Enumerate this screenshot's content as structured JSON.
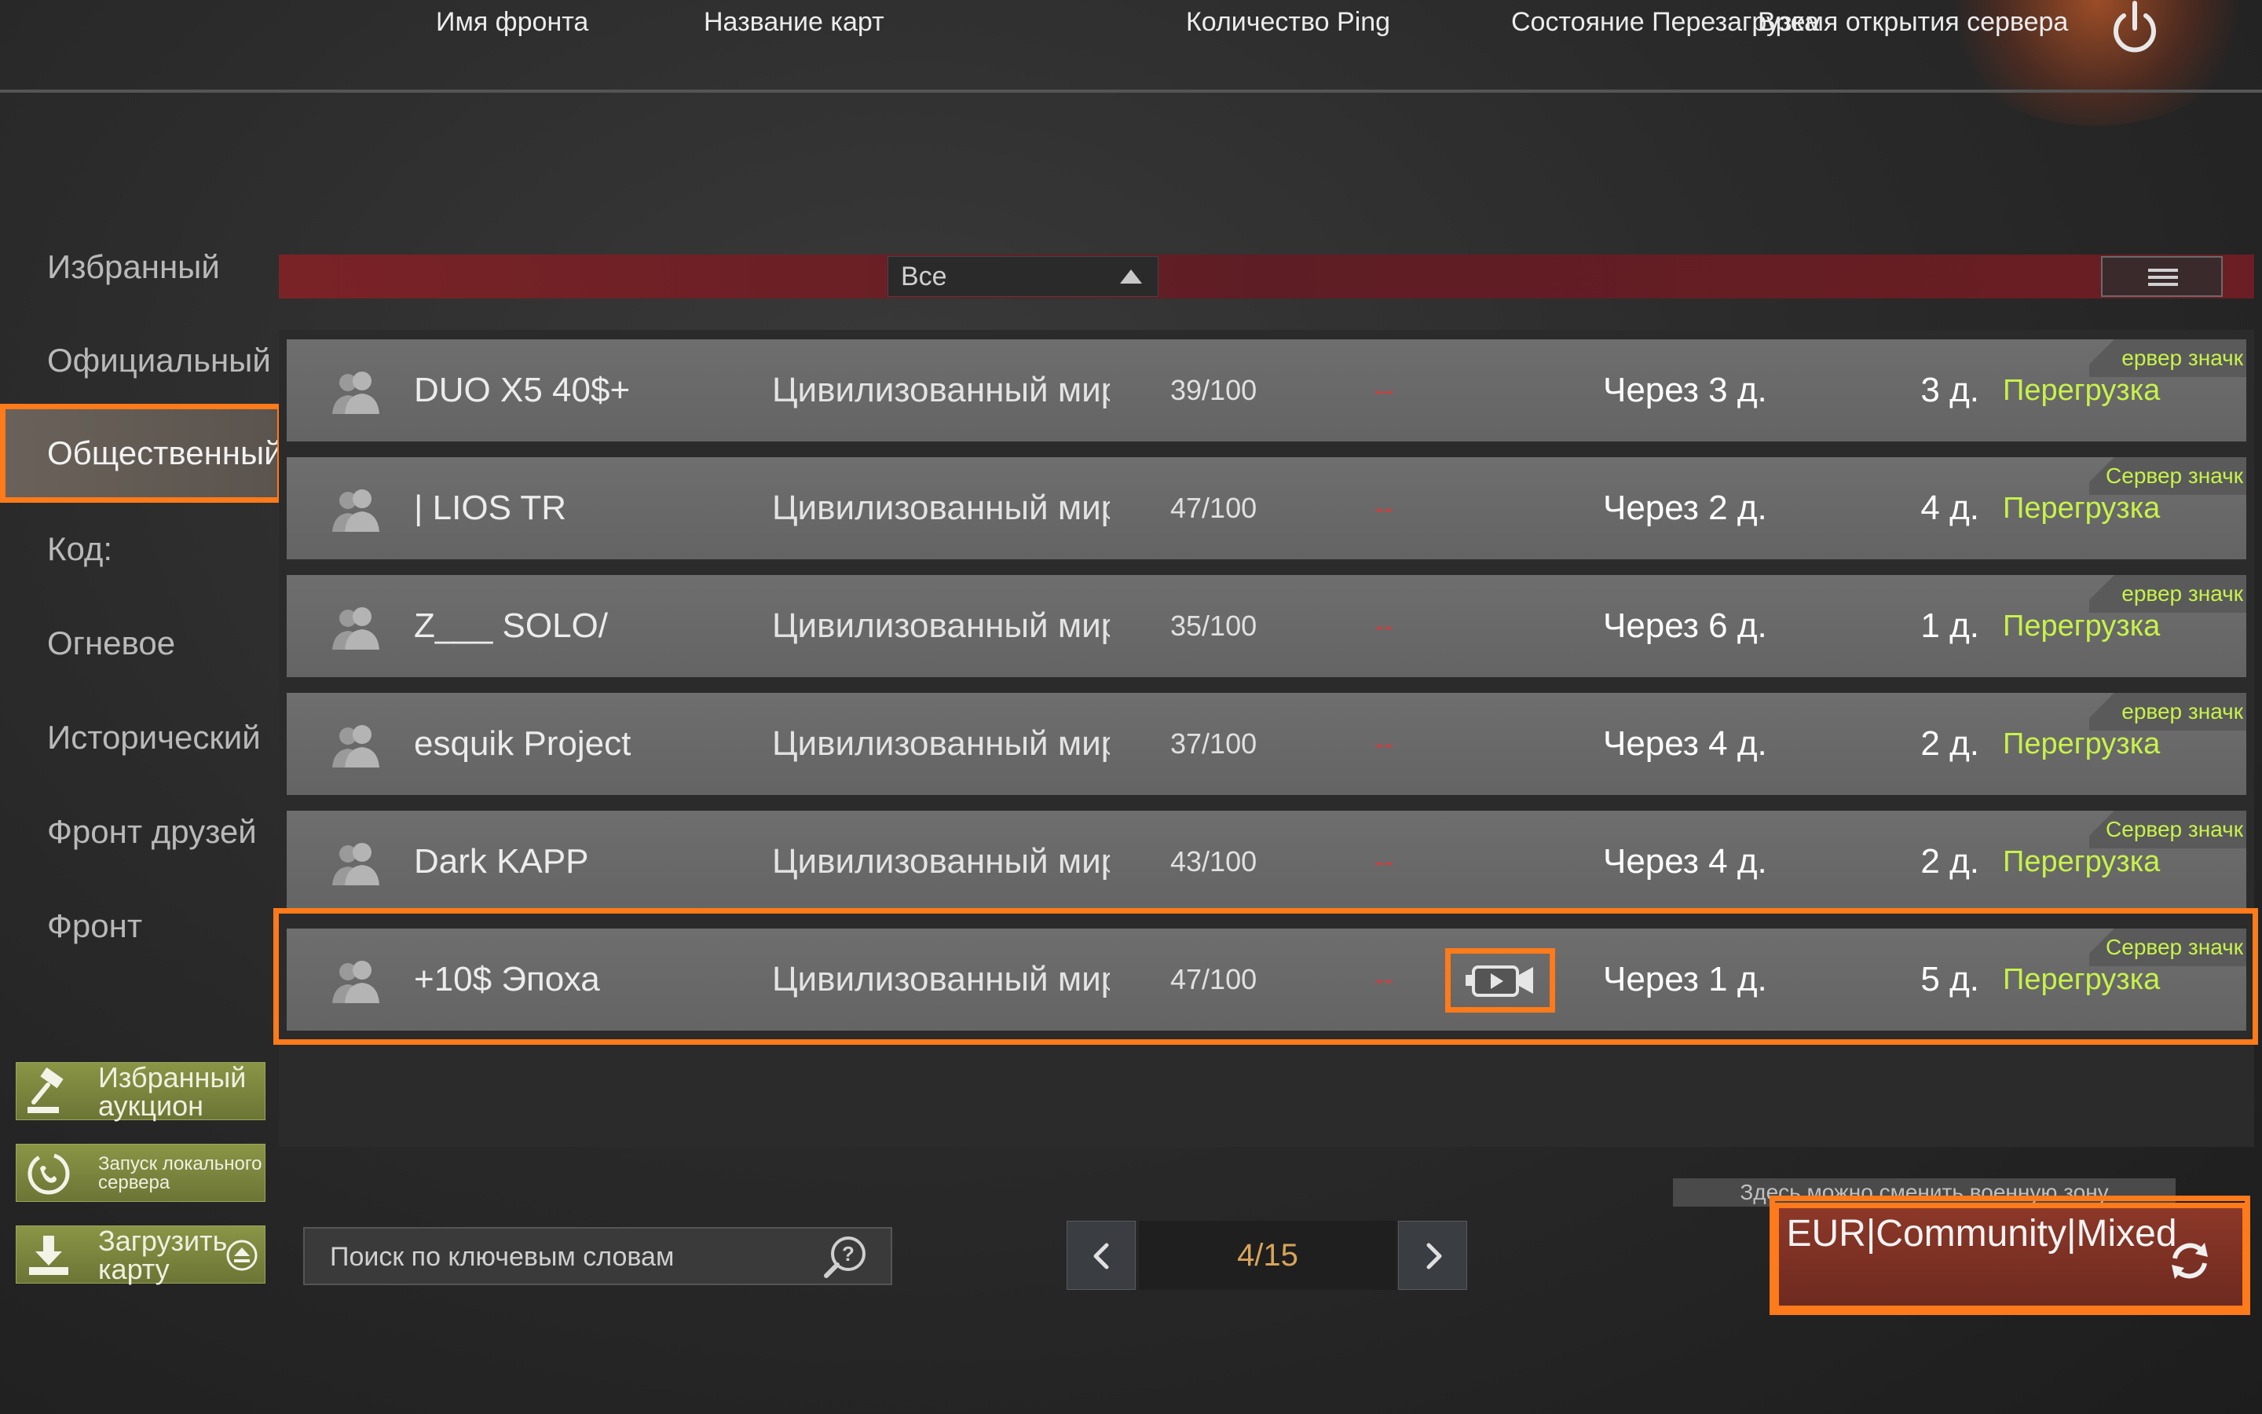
{
  "sidebar": {
    "items": [
      {
        "label": "Избранный"
      },
      {
        "label": "Официальный"
      },
      {
        "label": "Общественный"
      },
      {
        "label": "Код:"
      },
      {
        "label": "Огневое"
      },
      {
        "label": "Исторический"
      },
      {
        "label": "Фронт друзей"
      },
      {
        "label": "Фронт"
      }
    ],
    "active_index": 2,
    "buttons": [
      {
        "label": "Избранный аукцион",
        "icon": "gavel-icon"
      },
      {
        "label": "Запуск локального сервера",
        "icon": "phone-server-icon"
      },
      {
        "label": "Загрузить карту",
        "icon": "download-icon"
      }
    ]
  },
  "table": {
    "headers": {
      "name": "Имя фронта",
      "map": "Название карт",
      "filter_value": "Все",
      "count_ping": "Количество Ping",
      "state_reload": "Состояние Перезагрузка",
      "open_time": "Время открытия сервера"
    },
    "rows": [
      {
        "name": "DUO X5 40$+",
        "map": "Цивилизованный мир",
        "count": "39/100",
        "ping": "--",
        "reload": "Через 3 д.",
        "open": "3 д.",
        "status": "Перегрузка",
        "badge": "ервер значк"
      },
      {
        "name": "| LIOS TR",
        "map": "Цивилизованный мир",
        "count": "47/100",
        "ping": "--",
        "reload": "Через 2 д.",
        "open": "4 д.",
        "status": "Перегрузка",
        "badge": "Сервер значк"
      },
      {
        "name": "Z___ SOLO/",
        "map": "Цивилизованный мир",
        "count": "35/100",
        "ping": "--",
        "reload": "Через 6 д.",
        "open": "1 д.",
        "status": "Перегрузка",
        "badge": "ервер значк"
      },
      {
        "name": "esquik Project",
        "map": "Цивилизованный мир",
        "count": "37/100",
        "ping": "--",
        "reload": "Через 4 д.",
        "open": "2 д.",
        "status": "Перегрузка",
        "badge": "ервер значк"
      },
      {
        "name": "Dark KAPP",
        "map": "Цивилизованный мир",
        "count": "43/100",
        "ping": "--",
        "reload": "Через 4 д.",
        "open": "2 д.",
        "status": "Перегрузка",
        "badge": "Сервер значк"
      },
      {
        "name": "+10$ Эпоха",
        "map": "Цивилизованный мир",
        "count": "47/100",
        "ping": "--",
        "reload": "Через 1 д.",
        "open": "5 д.",
        "status": "Перегрузка",
        "badge": "Сервер значк",
        "has_stream": true
      }
    ]
  },
  "search": {
    "placeholder": "Поиск по ключевым словам"
  },
  "pagination": {
    "label": "4/15",
    "current": 4,
    "total": 15
  },
  "zone": {
    "hint": "Здесь можно сменить военную зону",
    "label": "EUR|Community|Mixed"
  },
  "colors": {
    "accent_highlight": "#ff7a1a",
    "header_red": "#6b1e23",
    "status_green": "#c7f24a",
    "ping_red": "#d23c3c",
    "page_number": "#d9a45a"
  }
}
